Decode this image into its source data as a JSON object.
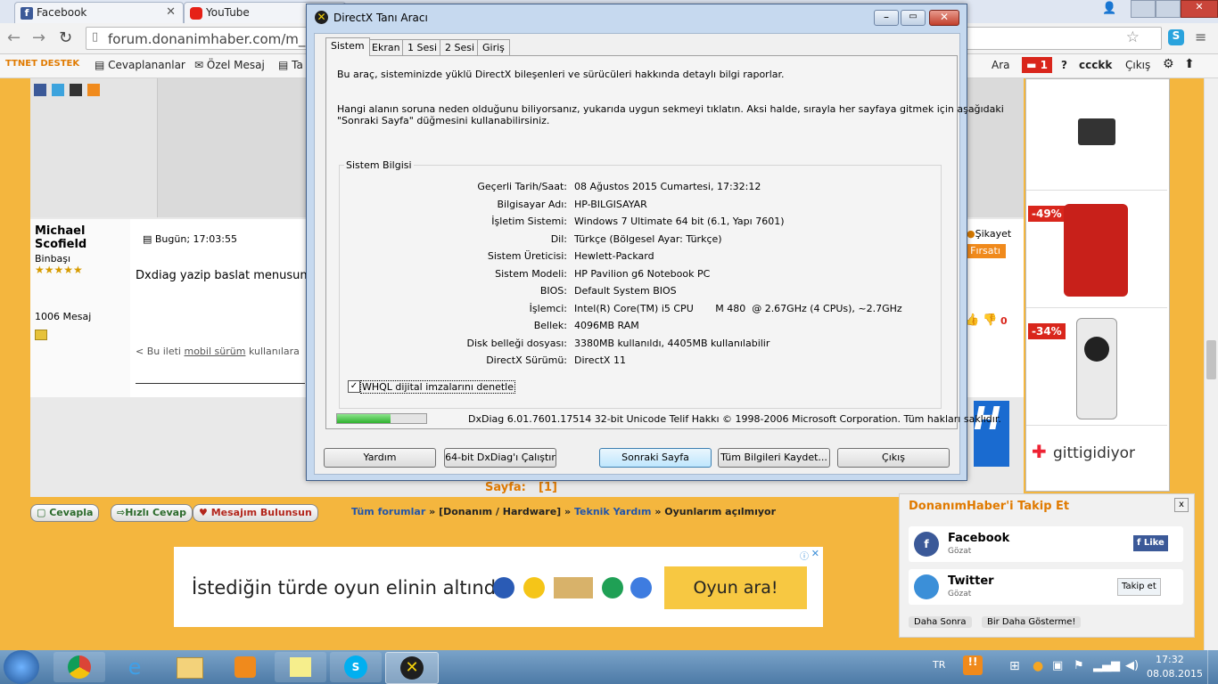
{
  "browser": {
    "tabs": [
      {
        "label": "Facebook",
        "icon": "facebook-icon"
      },
      {
        "label": "YouTube",
        "icon": "youtube-icon"
      }
    ],
    "url": "forum.donanimhaber.com/m_10",
    "bookmarks": [
      "Cevaplananlar",
      "Özel Mesaj",
      "Ta"
    ],
    "ttnet_logo": "TTNET DESTEK",
    "forum_topbar": {
      "search": "Ara",
      "notif_count": "1",
      "help": "?",
      "user": "ccckk",
      "logout": "Çıkış"
    }
  },
  "post": {
    "author": "Michael Scofield",
    "rank": "Binbaşı",
    "stars": "★★★★★",
    "message_count": "1006 Mesaj",
    "time": "Bugün; 17:03:55",
    "body": "Dxdiag yazip baslat menusun",
    "footer_prefix": "< Bu ileti",
    "footer_link": "mobil sürüm",
    "footer_suffix": "kullanılara",
    "complaint": "Şikayet",
    "opportunity": "Fırsatı",
    "dislike_count": "0"
  },
  "ads": [
    {
      "badge": ""
    },
    {
      "badge": "-49%"
    },
    {
      "badge": "-34%"
    },
    {
      "brand": "gittigidiyor"
    }
  ],
  "pager": {
    "label": "Sayfa:",
    "current": "[1]"
  },
  "actions": {
    "reply": "Cevapla",
    "quick_reply": "Hızlı Cevap",
    "found": "Mesajım Bulunsun"
  },
  "breadcrumb": {
    "all": "Tüm forumlar",
    "sep": "»",
    "cat": "[Donanım / Hardware]",
    "sub": "Teknik Yardım",
    "topic": "Oyunlarım açılmıyor"
  },
  "banner": {
    "text": "İstediğin türde oyun elinin altında",
    "cta": "Oyun ara!"
  },
  "follow": {
    "title": "DonanımHaber'i Takip Et",
    "close": "x",
    "facebook": {
      "name": "Facebook",
      "sub": "Gözat",
      "btn": "Like"
    },
    "twitter": {
      "name": "Twitter",
      "sub": "Gözat",
      "btn": "Takip et"
    },
    "later": "Daha Sonra",
    "never": "Bir Daha Gösterme!"
  },
  "dxdiag": {
    "title": "DirectX Tanı Aracı",
    "tabs": [
      "Sistem",
      "Ekran",
      "1 Sesi",
      "2 Sesi",
      "Giriş"
    ],
    "intro": "Bu araç, sisteminizde yüklü DirectX bileşenleri ve sürücüleri hakkında detaylı bilgi raporlar.",
    "hint1": "Hangi alanın soruna neden olduğunu biliyorsanız, yukarıda uygun sekmeyi tıklatın.  Aksi halde, sırayla her sayfaya gitmek için aşağıdaki",
    "hint2": "\"Sonraki Sayfa\" düğmesini kullanabilirsiniz.",
    "group_title": "Sistem Bilgisi",
    "rows": [
      {
        "k": "Geçerli Tarih/Saat:",
        "v": "08 Ağustos 2015 Cumartesi, 17:32:12"
      },
      {
        "k": "Bilgisayar Adı:",
        "v": "HP-BILGISAYAR"
      },
      {
        "k": "İşletim Sistemi:",
        "v": "Windows 7 Ultimate 64 bit (6.1, Yapı 7601)"
      },
      {
        "k": "Dil:",
        "v": "Türkçe (Bölgesel Ayar: Türkçe)"
      },
      {
        "k": "Sistem Üreticisi:",
        "v": "Hewlett-Packard"
      },
      {
        "k": "Sistem Modeli:",
        "v": "HP Pavilion g6 Notebook PC"
      },
      {
        "k": "BIOS:",
        "v": "Default System BIOS"
      },
      {
        "k": "İşlemci:",
        "v": "Intel(R) Core(TM) i5 CPU       M 480  @ 2.67GHz (4 CPUs), ~2.7GHz"
      },
      {
        "k": "Bellek:",
        "v": "4096MB RAM"
      },
      {
        "k": "Disk belleği dosyası:",
        "v": "3380MB kullanıldı, 4405MB kullanılabilir"
      },
      {
        "k": "DirectX Sürümü:",
        "v": "DirectX 11"
      }
    ],
    "whql": "WHQL dijital imzalarını denetle",
    "progress": 0.6,
    "copyright": "DxDiag 6.01.7601.17514 32-bit Unicode  Telif Hakkı © 1998-2006 Microsoft Corporation.  Tüm hakları saklıdır.",
    "buttons": {
      "help": "Yardım",
      "run64": "64-bit DxDiag'ı Çalıştır",
      "next": "Sonraki Sayfa",
      "save": "Tüm Bilgileri Kaydet...",
      "exit": "Çıkış"
    }
  },
  "taskbar": {
    "lang": "TR",
    "time": "17:32",
    "date": "08.08.2015"
  }
}
